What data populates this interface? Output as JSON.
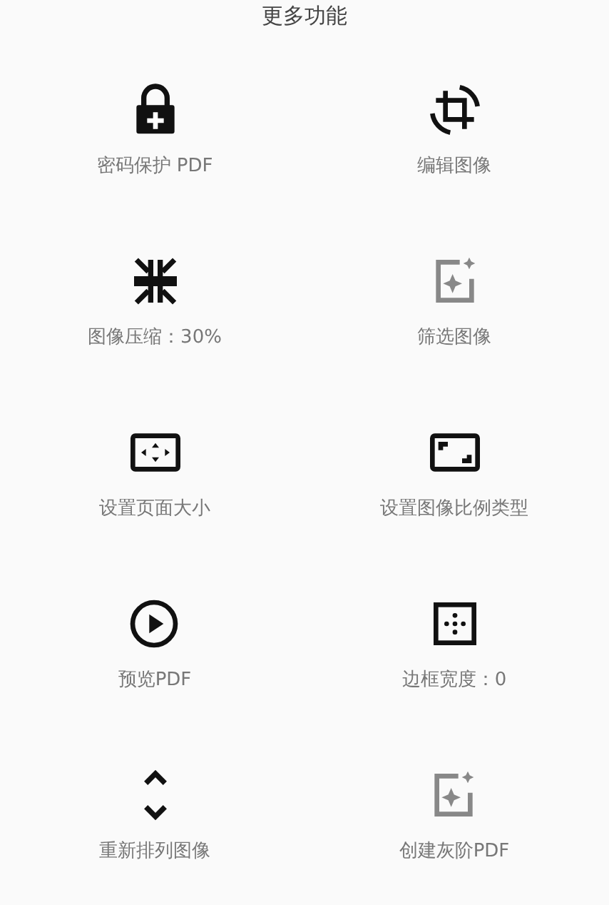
{
  "title": "更多功能",
  "features": [
    {
      "kind": "lock",
      "label": "密码保护 PDF"
    },
    {
      "kind": "crop",
      "label": "编辑图像"
    },
    {
      "kind": "compress",
      "label": "图像压缩：30%"
    },
    {
      "kind": "filter",
      "label": "筛选图像"
    },
    {
      "kind": "page-size",
      "label": "设置页面大小"
    },
    {
      "kind": "aspect",
      "label": "设置图像比例类型"
    },
    {
      "kind": "play",
      "label": "预览PDF"
    },
    {
      "kind": "border",
      "label": "边框宽度：0"
    },
    {
      "kind": "reorder",
      "label": "重新排列图像"
    },
    {
      "kind": "filter",
      "label": "创建灰阶PDF"
    }
  ]
}
